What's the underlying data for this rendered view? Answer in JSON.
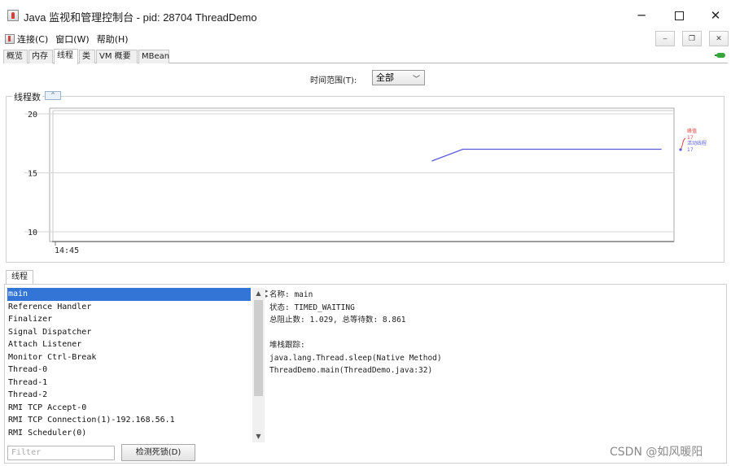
{
  "window": {
    "title": "Java 监视和管理控制台 - pid: 28704 ThreadDemo",
    "controls": {
      "minimize": "─",
      "maximize": "",
      "close": "✕"
    }
  },
  "menu": {
    "items": [
      "连接(C)",
      "窗口(W)",
      "帮助(H)"
    ]
  },
  "mdi_controls": {
    "minimize": "‒",
    "restore": "❐",
    "close": "✕"
  },
  "tabs": [
    "概览",
    "内存",
    "线程",
    "类",
    "VM 概要",
    "MBean"
  ],
  "active_tab": "线程",
  "time_range": {
    "label": "时间范围(T):",
    "value": "全部"
  },
  "chart": {
    "title": "线程数",
    "badge": "^",
    "legend": {
      "peak": "峰值",
      "peak_value": "17",
      "live": "活动线程",
      "live_value": "17"
    }
  },
  "chart_data": {
    "type": "line",
    "title": "线程数",
    "xlabel": "",
    "ylabel": "",
    "x_ticks": [
      "14:45"
    ],
    "y_ticks": [
      10,
      15,
      20
    ],
    "ylim": [
      10,
      20
    ],
    "grid": true,
    "legend_position": "right",
    "series": [
      {
        "name": "活动线程",
        "color": "#5a5adc",
        "x": [
          0.61,
          0.66,
          0.98
        ],
        "values": [
          16,
          17,
          17
        ]
      }
    ]
  },
  "threads_panel": {
    "tab_label": "线程",
    "list": [
      "main",
      "Reference Handler",
      "Finalizer",
      "Signal Dispatcher",
      "Attach Listener",
      "Monitor Ctrl-Break",
      "Thread-0",
      "Thread-1",
      "Thread-2",
      "RMI TCP Accept-0",
      "RMI TCP Connection(1)-192.168.56.1",
      "RMI Scheduler(0)"
    ],
    "selected_index": 0,
    "detail": {
      "name": "名称: main",
      "state": "状态: TIMED_WAITING",
      "counts": "总阻止数: 1.029, 总等待数: 8.861",
      "stack_header": "堆栈跟踪:",
      "stack": [
        "java.lang.Thread.sleep(Native Method)",
        "ThreadDemo.main(ThreadDemo.java:32)"
      ]
    },
    "filter_placeholder": "Filter",
    "deadlock_button": "检测死锁(D)"
  },
  "watermark": "CSDN @如风暖阳"
}
